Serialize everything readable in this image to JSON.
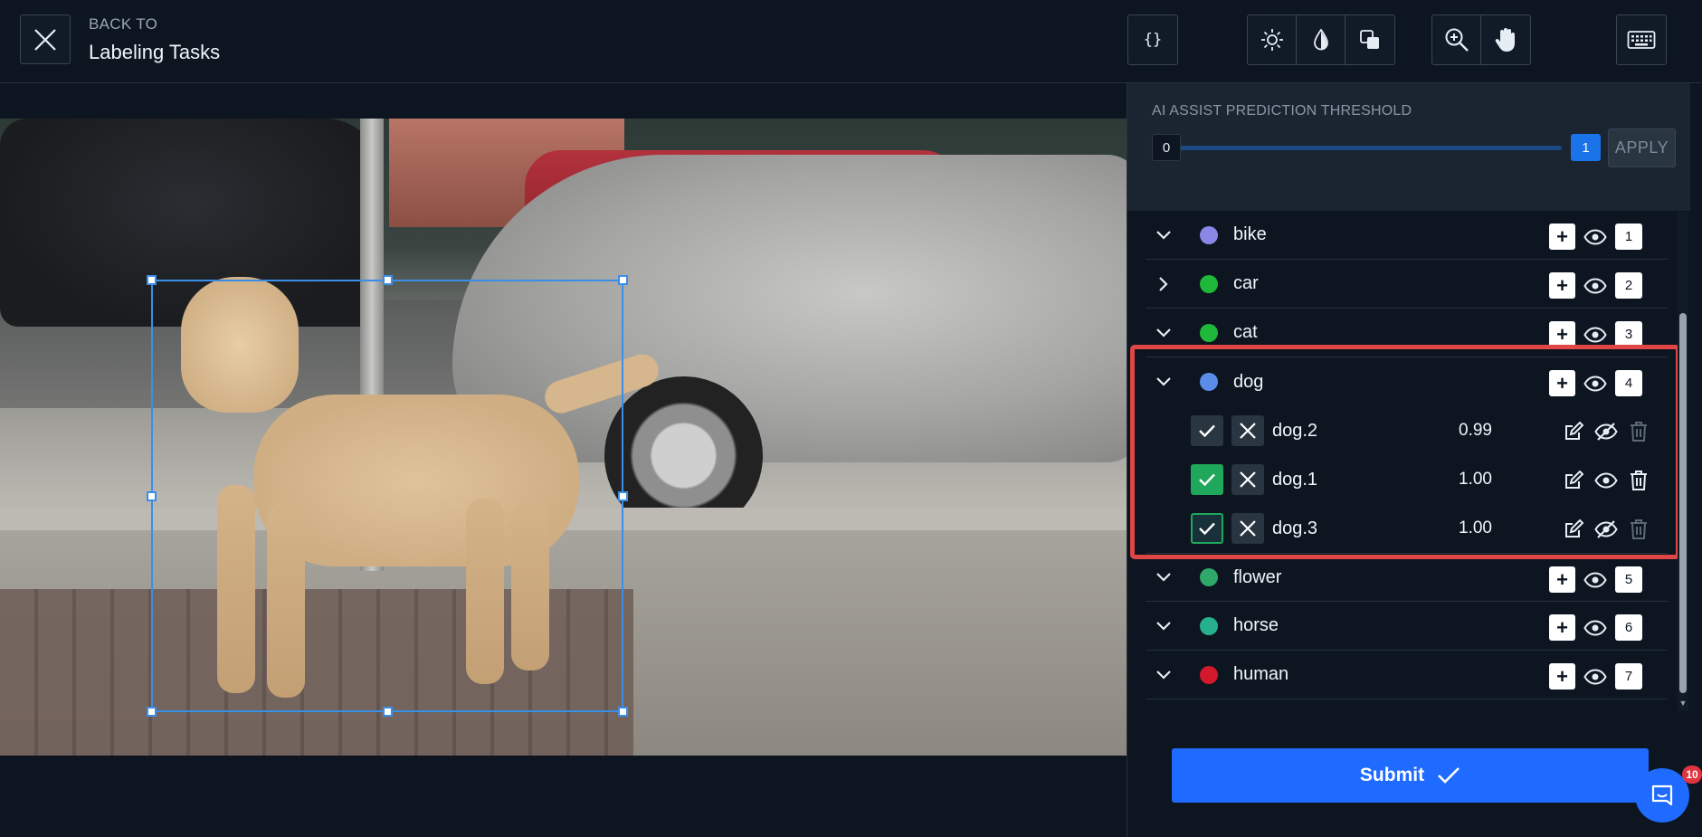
{
  "header": {
    "back_to": "BACK TO",
    "title": "Labeling Tasks",
    "json_label": "{}"
  },
  "threshold": {
    "label": "AI ASSIST PREDICTION THRESHOLD",
    "min": "0",
    "max": "1",
    "apply_label": "APPLY"
  },
  "classes": [
    {
      "name": "bike",
      "color": "#8b87e6",
      "number": "1",
      "expanded": true
    },
    {
      "name": "car",
      "color": "#1fb83a",
      "number": "2",
      "expanded": false
    },
    {
      "name": "cat",
      "color": "#1fb83a",
      "number": "3",
      "expanded": true
    },
    {
      "name": "dog",
      "color": "#5b8de8",
      "number": "4",
      "expanded": true
    },
    {
      "name": "flower",
      "color": "#2fa86a",
      "number": "5",
      "expanded": true
    },
    {
      "name": "horse",
      "color": "#27b08d",
      "number": "6",
      "expanded": true
    },
    {
      "name": "human",
      "color": "#d4182c",
      "number": "7",
      "expanded": true
    }
  ],
  "instances": [
    {
      "name": "dog.2",
      "score": "0.99",
      "state": "default",
      "visible": false
    },
    {
      "name": "dog.1",
      "score": "1.00",
      "state": "accepted",
      "visible": true
    },
    {
      "name": "dog.3",
      "score": "1.00",
      "state": "selected",
      "visible": false
    }
  ],
  "submit_label": "Submit",
  "chat_badge": "10",
  "colors": {
    "accent": "#1f6bff",
    "bbox": "#3b8ee8",
    "highlight": "#e04646",
    "accepted": "#1fa85c"
  }
}
